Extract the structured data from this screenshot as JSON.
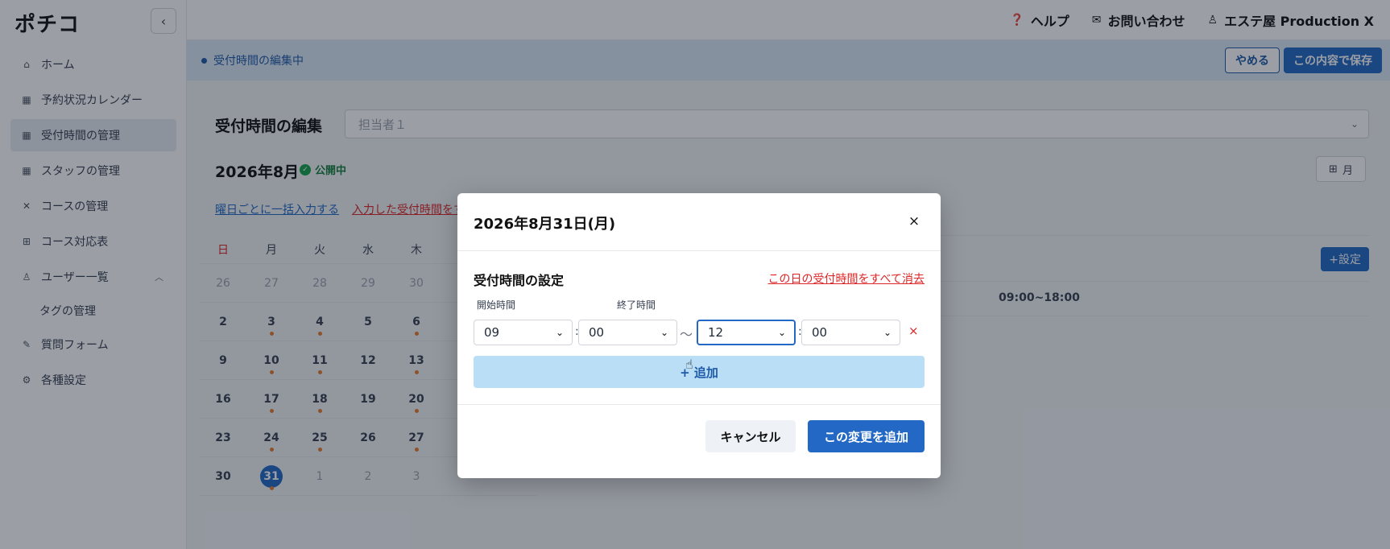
{
  "app": {
    "logo": "ポチコ",
    "collapse_icon": "‹"
  },
  "sidebar": {
    "items": [
      {
        "label": "ホーム",
        "icon": "home-icon"
      },
      {
        "label": "予約状況カレンダー",
        "icon": "calendar-icon"
      },
      {
        "label": "受付時間の管理",
        "icon": "calendar-check-icon",
        "active": true
      },
      {
        "label": "スタッフの管理",
        "icon": "calendar-icon"
      },
      {
        "label": "コースの管理",
        "icon": "utensils-icon"
      },
      {
        "label": "コース対応表",
        "icon": "grid-icon"
      },
      {
        "label": "ユーザー一覧",
        "icon": "user-icon",
        "expanded": true
      }
    ],
    "sub_items": [
      {
        "label": "タグの管理"
      }
    ],
    "items_after": [
      {
        "label": "質問フォーム",
        "icon": "form-icon"
      },
      {
        "label": "各種設定",
        "icon": "gear-icon"
      }
    ]
  },
  "header": {
    "help": "ヘルプ",
    "contact": "お問い合わせ",
    "account": "エステ屋 Production X"
  },
  "editbar": {
    "status": "受付時間の編集中",
    "discard": "やめる",
    "save": "この内容で保存"
  },
  "main": {
    "title": "受付時間の編集",
    "staff_placeholder": "担当者１",
    "month": "2026年8月",
    "published": "公開中",
    "view_mode": "月",
    "bulk_link": "曜日ごとに一括入力する",
    "clear_link": "入力した受付時間をす",
    "set_button": "+設定",
    "slot_text": "09:00~18:00"
  },
  "calendar": {
    "weekdays": [
      "日",
      "月",
      "火",
      "水",
      "木"
    ],
    "weeks": [
      [
        {
          "d": "26",
          "m": true
        },
        {
          "d": "27",
          "m": true
        },
        {
          "d": "28",
          "m": true
        },
        {
          "d": "29",
          "m": true
        },
        {
          "d": "30",
          "m": true
        }
      ],
      [
        {
          "d": "2"
        },
        {
          "d": "3",
          "dot": true
        },
        {
          "d": "4",
          "dot": true
        },
        {
          "d": "5"
        },
        {
          "d": "6",
          "dot": true
        }
      ],
      [
        {
          "d": "9"
        },
        {
          "d": "10",
          "dot": true
        },
        {
          "d": "11",
          "dot": true
        },
        {
          "d": "12"
        },
        {
          "d": "13",
          "dot": true
        }
      ],
      [
        {
          "d": "16"
        },
        {
          "d": "17",
          "dot": true
        },
        {
          "d": "18",
          "dot": true
        },
        {
          "d": "19"
        },
        {
          "d": "20",
          "dot": true
        }
      ],
      [
        {
          "d": "23"
        },
        {
          "d": "24",
          "dot": true
        },
        {
          "d": "25",
          "dot": true
        },
        {
          "d": "26"
        },
        {
          "d": "27",
          "dot": true
        }
      ],
      [
        {
          "d": "30"
        },
        {
          "d": "31",
          "dot": true,
          "today": true
        },
        {
          "d": "1",
          "m": true
        },
        {
          "d": "2",
          "m": true
        },
        {
          "d": "3",
          "m": true
        }
      ]
    ]
  },
  "modal": {
    "title": "2026年8月31日(月)",
    "close": "×",
    "section_title": "受付時間の設定",
    "clear_day": "この日の受付時間をすべて消去",
    "start_label": "開始時間",
    "end_label": "終了時間",
    "start_hour": "09",
    "start_min": "00",
    "end_hour": "12",
    "end_min": "00",
    "colon": ":",
    "tilde": "〜",
    "remove": "×",
    "add": "+ 追加",
    "cancel": "キャンセル",
    "apply": "この変更を追加"
  },
  "colors": {
    "primary": "#2268c4",
    "danger": "#dc2626",
    "success": "#16a34a",
    "dot": "#ea7a2e"
  }
}
